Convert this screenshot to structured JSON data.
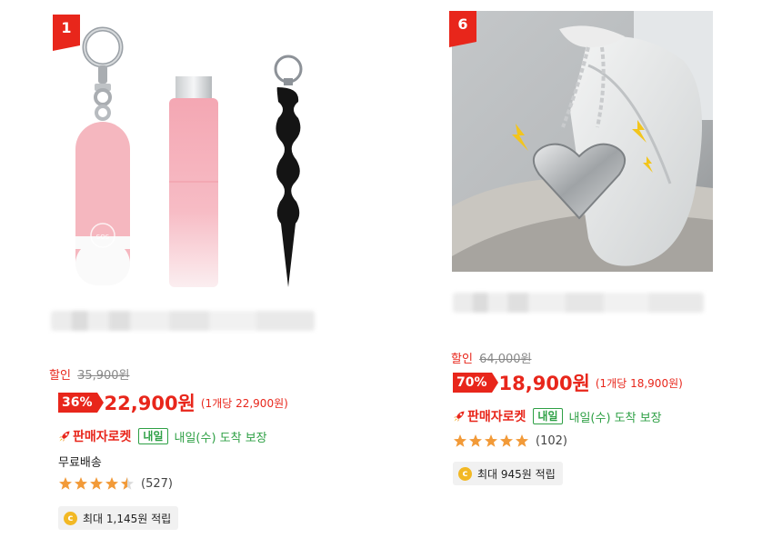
{
  "products": [
    {
      "rank": "1",
      "sale_label": "할인",
      "original_price": "35,900원",
      "discount": "36%",
      "price": "22,900원",
      "unit_price": "(1개당 22,900원)",
      "rocket_label": "판매자로켓",
      "tomorrow_tag": "내일",
      "arrival": "내일(수) 도착 보장",
      "shipping": "무료배송",
      "rating": 4.5,
      "review_count": "(527)",
      "cashback": "최대 1,145원 적립"
    },
    {
      "rank": "6",
      "sale_label": "할인",
      "original_price": "64,000원",
      "discount": "70%",
      "price": "18,900원",
      "unit_price": "(1개당 18,900원)",
      "rocket_label": "판매자로켓",
      "tomorrow_tag": "내일",
      "arrival": "내일(수) 도착 보장",
      "rating": 5,
      "review_count": "(102)",
      "cashback": "최대 945원 적립"
    }
  ],
  "colors": {
    "accent": "#e8261b",
    "green": "#2ea045",
    "star": "#f29a38",
    "coin": "#f2b824"
  },
  "icons": [
    "rocket-icon",
    "star-icon",
    "coin-icon"
  ]
}
